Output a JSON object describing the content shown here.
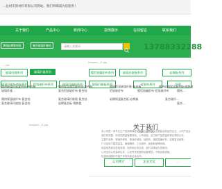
{
  "topbar": {
    "text": "...丝材天新材料有限公司网站，我们将竭诚为您服务！"
  },
  "nav": {
    "items": [
      "关于我们",
      "产品中心",
      "新闻中心",
      "案例展示",
      "在线留言",
      "联系我们"
    ]
  },
  "header": {
    "tags": [
      "增强岩棉管材料",
      "复合玻璃纤维毡"
    ],
    "search_placeholder": "请输入关键词",
    "phone": "13788332288"
  },
  "images": {
    "banner": "images/.../2.jpg",
    "products_banner": "images/.../pro1.jpg",
    "about_pic": "images/.../1.jpg",
    "product_placeholder": "...-pic"
  },
  "categories": {
    "row1": [
      "玻璃纤维系列",
      "玻璃纤维系列",
      "镀铝箔编织布系列",
      "玻璃纤维板系列",
      "岩棉板系列"
    ],
    "row2": [
      "玻璃纤维针刺毡系列",
      "铝箔玻纤布系列",
      "玻璃纤维毡系列",
      "玻璃纤维板系列",
      "硅胶布系列",
      "空调..."
    ]
  },
  "products": {
    "row1": [
      "隔热玻璃纤维复合毡-复合板",
      "隔热保温隔音玻纤毯-复合毡",
      "隔热保温玻璃纤维-复合板",
      "隔热岩棉保温复合板-隔热毯"
    ],
    "row1_sub": [
      "玻璃纤维...",
      "复合铝箔玻纤布-复合毡",
      "铝箔玻纤布",
      "镀铝箔编织布-铝箔玻纤布",
      "隔热..."
    ],
    "row2": [
      "隔热保温玻纤布-复合毡",
      "复合玻璃纤维毯-复合毡",
      "岩棉保温复合板-岩棉板",
      "复合玻纤..."
    ],
    "row2_sub": [
      "复合玻璃纤维毡-复合毡",
      "岩棉复合板-隔热毯",
      "复合..."
    ]
  },
  "about": {
    "title": "关于我们",
    "subtitle": "ABOUT US",
    "lines": [
      "本公司是一家专业生产各类玻璃纤维制品、硅酸铝、岩棉复合制品的企业，公司产品远销海内外。",
      "我们有完整、科学的质量管理体系。公司诚信、实力和产品质量获得业界的认可。",
      "主要产品有：玻璃纤维布、玻璃纤维毡、硅胶布、镀铝箔编织布、岩棉复合板等。",
      "广泛应用于建筑保温、管道隔热、工业窑炉、船舶制造等领域。",
      "欢迎各界朋友莅临参观、指导和业务洽谈，我们将竭诚为您服务。",
      "公司坚持以质量求生存，以信誉求发展的经营理念，不断创新进取。",
      "热诚欢迎国内外客户来电来函洽谈合作。"
    ],
    "buttons": [
      "公司简介",
      "企业文化",
      "..."
    ]
  }
}
